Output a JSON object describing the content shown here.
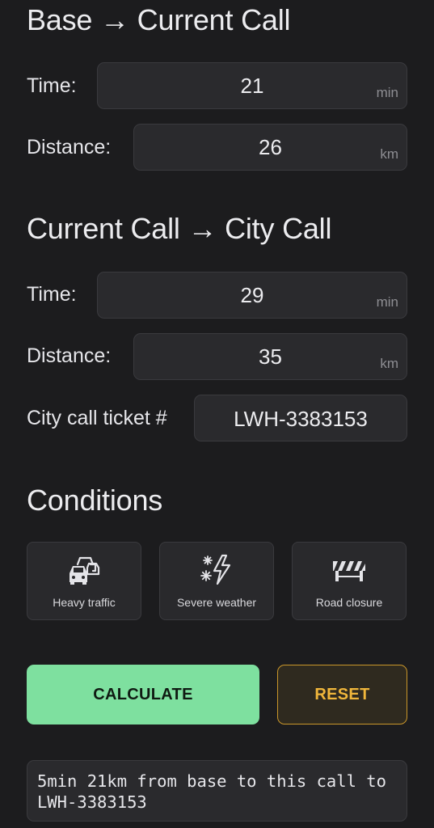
{
  "leg1": {
    "title": "Base → Current Call",
    "time_label": "Time:",
    "time_value": "21",
    "time_unit": "min",
    "distance_label": "Distance:",
    "distance_value": "26",
    "distance_unit": "km"
  },
  "leg2": {
    "title": "Current Call → City Call",
    "time_label": "Time:",
    "time_value": "29",
    "time_unit": "min",
    "distance_label": "Distance:",
    "distance_value": "35",
    "distance_unit": "km",
    "ticket_label": "City call ticket #",
    "ticket_value": "LWH-3383153"
  },
  "conditions": {
    "title": "Conditions",
    "items": [
      {
        "label": "Heavy traffic",
        "icon": "traffic-cars-icon"
      },
      {
        "label": "Severe weather",
        "icon": "snow-lightning-icon"
      },
      {
        "label": "Road closure",
        "icon": "road-barrier-icon"
      }
    ]
  },
  "actions": {
    "calculate_label": "CALCULATE",
    "reset_label": "RESET"
  },
  "output": {
    "text": "5min 21km from base to this call to LWH-3383153"
  },
  "colors": {
    "background": "#1c1c1e",
    "calculate": "#7ee09f",
    "reset_text": "#f0b63b",
    "reset_border": "#c9962a"
  }
}
